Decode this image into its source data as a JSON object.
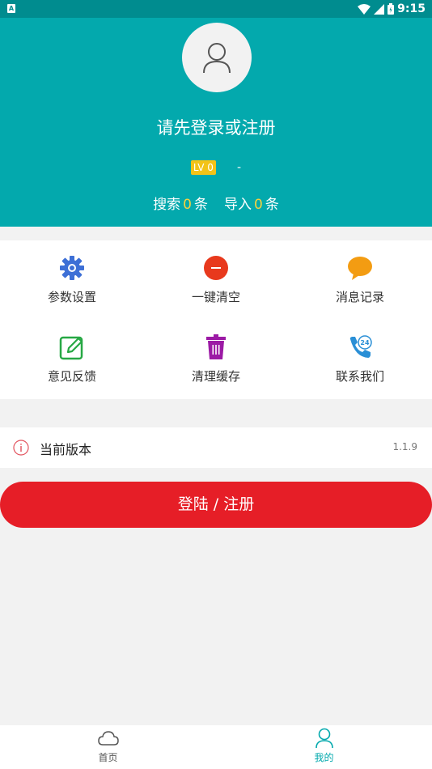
{
  "status_bar": {
    "time": "9:15"
  },
  "header": {
    "login_prompt": "请先登录或注册",
    "level_badge": "LV 0",
    "level_name": "-",
    "stats": {
      "search_label": "搜索",
      "search_count": "0",
      "search_unit": "条",
      "import_label": "导入",
      "import_count": "0",
      "import_unit": "条"
    }
  },
  "menu": [
    {
      "label": "参数设置",
      "icon": "gear-icon",
      "color": "#3d6fd6"
    },
    {
      "label": "一键清空",
      "icon": "clear-icon",
      "color": "#e8391d"
    },
    {
      "label": "消息记录",
      "icon": "message-icon",
      "color": "#f39c12"
    },
    {
      "label": "意见反馈",
      "icon": "edit-icon",
      "color": "#27a844"
    },
    {
      "label": "清理缓存",
      "icon": "trash-icon",
      "color": "#9c1aa5"
    },
    {
      "label": "联系我们",
      "icon": "phone-24-icon",
      "color": "#2a8fd6"
    }
  ],
  "version": {
    "label": "当前版本",
    "value": "1.1.9"
  },
  "login_button": "登陆 / 注册",
  "bottom_nav": [
    {
      "label": "首页",
      "icon": "cloud-icon",
      "active": false
    },
    {
      "label": "我的",
      "icon": "person-icon",
      "active": true
    }
  ],
  "colors": {
    "accent": "#03a9ad",
    "status_bar": "#008c8f",
    "button": "#e61e27",
    "highlight": "#f7d23e"
  }
}
